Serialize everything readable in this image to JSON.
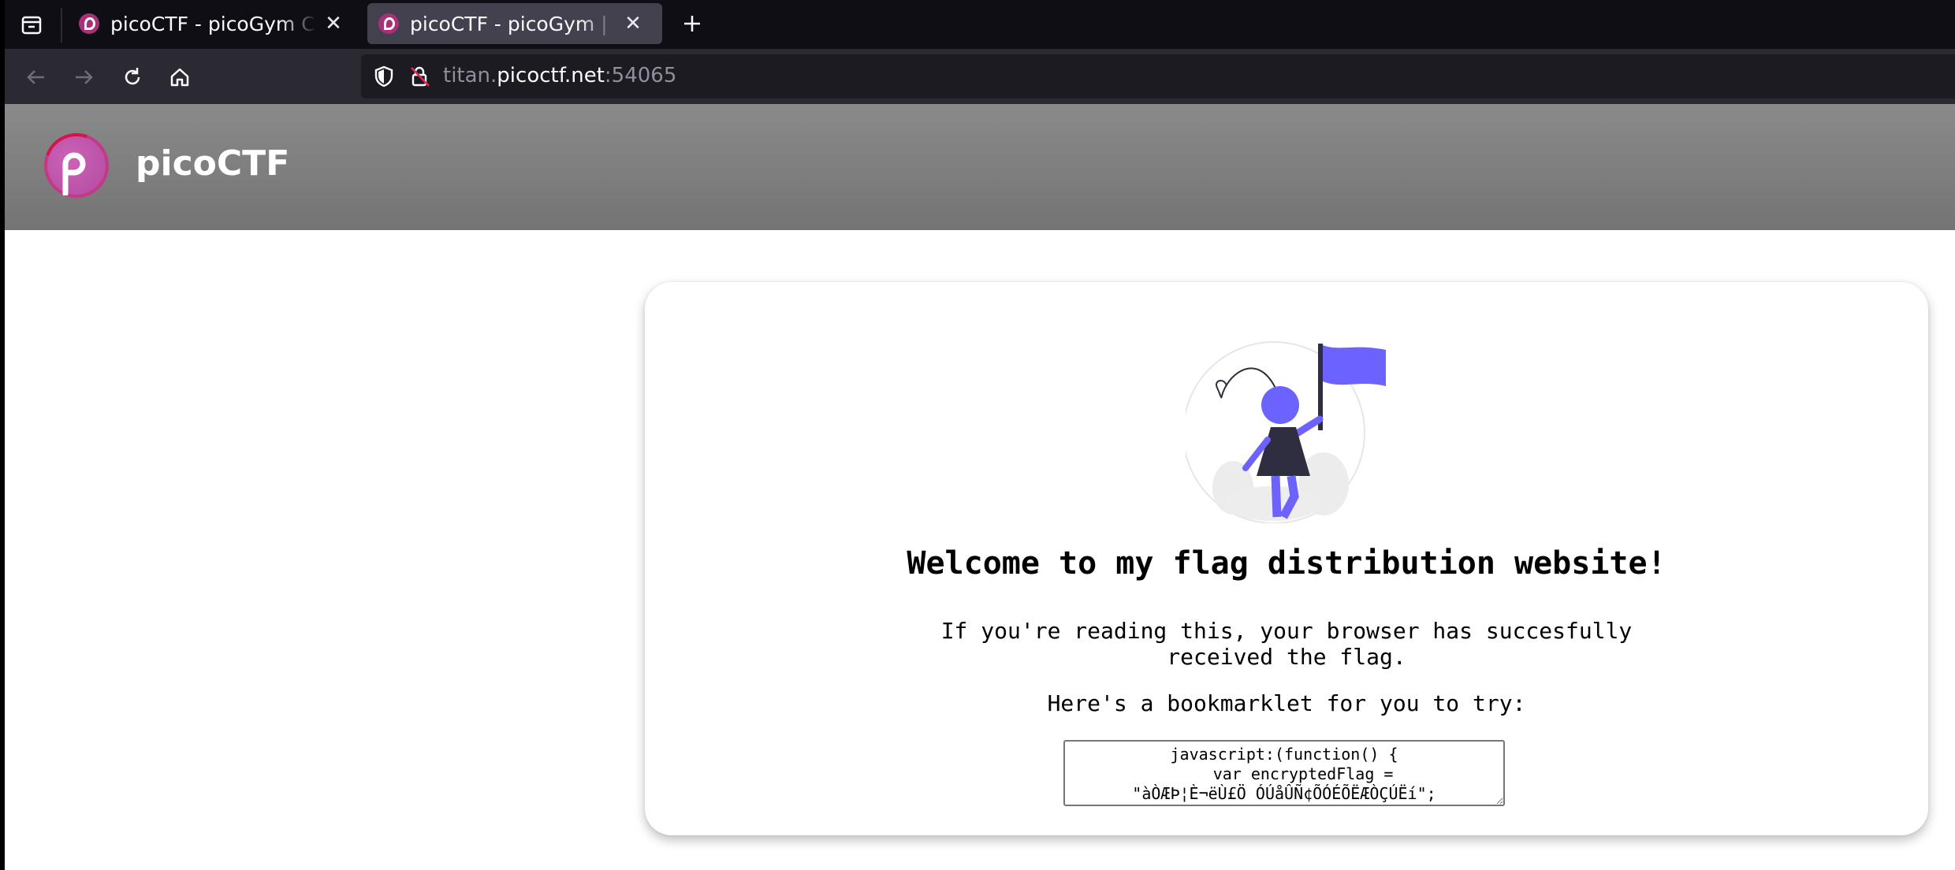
{
  "tabs": [
    {
      "title": "picoCTF - picoGym Challenges",
      "active": false
    },
    {
      "title": "picoCTF - picoGym | Bookmarklet",
      "active": true
    }
  ],
  "address_bar": {
    "url_prefix": "titan.",
    "url_host": "picoctf.net",
    "url_suffix": ":54065"
  },
  "site": {
    "brand": "picoCTF"
  },
  "content": {
    "heading": "Welcome to my flag distribution website!",
    "lead_line1": "If you're reading this, your browser has succesfully",
    "lead_line2": "received the flag.",
    "bookmarklet_intro": "Here's a bookmarklet for you to try:",
    "bookmarklet_code": "javascript:(function() {\n    var encryptedFlag = \"àÒÆÞ¦È¬ëÙ£ÖÓÚåÛÑ¢ÕÓÉÕËÆÒÇÚËí\";"
  },
  "colors": {
    "accent_purple": "#6c63ff",
    "brand_magenta": "#c23a86",
    "brand_red": "#d4134a",
    "header_gray": "#7f7f7f"
  }
}
